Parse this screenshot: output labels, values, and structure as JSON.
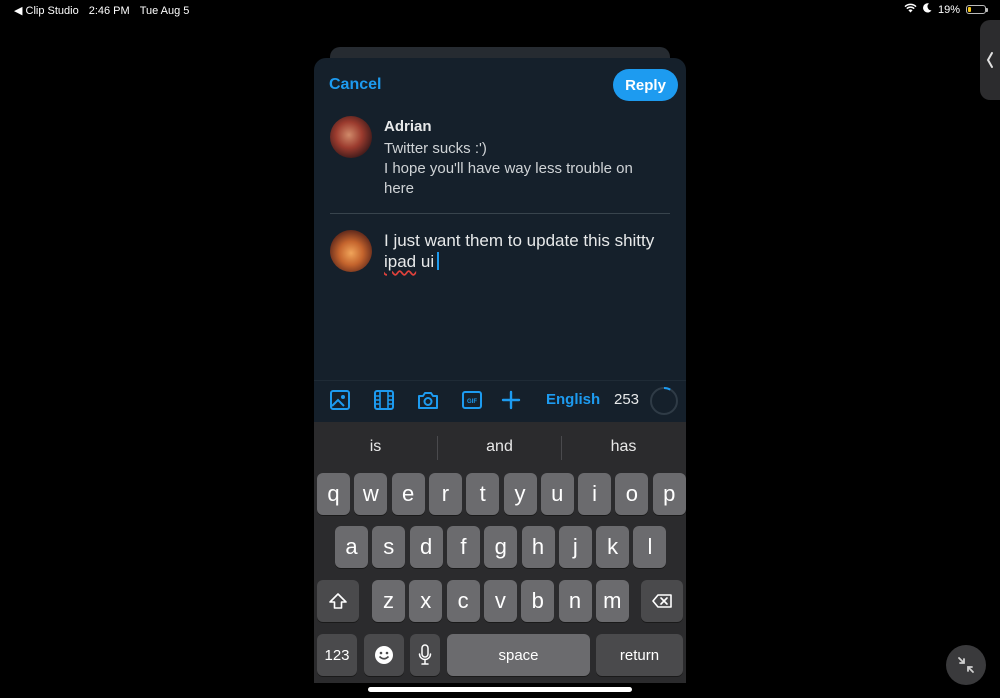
{
  "status_bar": {
    "back_app": "◀ Clip Studio",
    "time": "2:46 PM",
    "date": "Tue Aug 5",
    "battery_percent": "19%",
    "battery_level": 0.19,
    "icons": [
      "wifi-icon",
      "moon-icon",
      "battery-icon"
    ]
  },
  "header": {
    "cancel_label": "Cancel",
    "reply_label": "Reply"
  },
  "original_post": {
    "author": "Adrian",
    "lines": [
      "Twitter sucks :')",
      "I hope you'll have way less trouble on",
      "here"
    ]
  },
  "compose": {
    "line1": "I just want them to update this shitty",
    "misspelled": "ipad",
    "rest": " ui"
  },
  "toolbar": {
    "icons": [
      "image-icon",
      "video-icon",
      "camera-icon",
      "gif-icon",
      "add-icon"
    ],
    "language": "English",
    "char_count": "253",
    "progress": 0.08
  },
  "keyboard": {
    "suggestions": [
      "is",
      "and",
      "has"
    ],
    "row1": [
      "q",
      "w",
      "e",
      "r",
      "t",
      "y",
      "u",
      "i",
      "o",
      "p"
    ],
    "row2": [
      "a",
      "s",
      "d",
      "f",
      "g",
      "h",
      "j",
      "k",
      "l"
    ],
    "row3": [
      "z",
      "x",
      "c",
      "v",
      "b",
      "n",
      "m"
    ],
    "numbers_label": "123",
    "space_label": "space",
    "return_label": "return"
  },
  "colors": {
    "accent": "#1d9bf0",
    "sheet_bg": "#15202b",
    "keyboard_bg": "#2b2b2d",
    "key": "#6b6b6e"
  }
}
